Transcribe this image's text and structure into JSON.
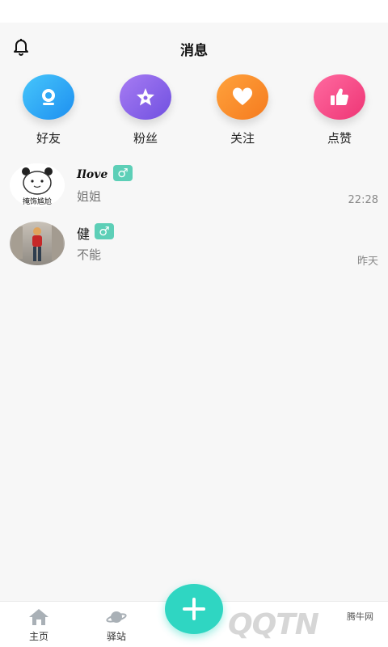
{
  "header": {
    "title": "消息"
  },
  "quick_actions": [
    {
      "label": "好友",
      "icon": "user-icon",
      "color": "#2fa8f5"
    },
    {
      "label": "粉丝",
      "icon": "star-icon",
      "color": "#8a63e8"
    },
    {
      "label": "关注",
      "icon": "heart-icon",
      "color": "#fb8f2a"
    },
    {
      "label": "点赞",
      "icon": "thumbs-up-icon",
      "color": "#f64d8a"
    }
  ],
  "messages": [
    {
      "name": "Ilove",
      "gender": "♂",
      "preview": "姐姐",
      "time": "22:28",
      "avatar_caption": "掩饰尴尬"
    },
    {
      "name": "健",
      "gender": "♂",
      "preview": "不能",
      "time": "昨天"
    }
  ],
  "tabbar": {
    "items": [
      {
        "label": "主页",
        "icon": "home-icon"
      },
      {
        "label": "驿站",
        "icon": "planet-icon"
      }
    ]
  },
  "watermark": {
    "logo": "QQTN",
    "site": "腾牛网"
  },
  "colors": {
    "accent": "#2fd6c2",
    "gender_badge": "#5dcfb7"
  }
}
